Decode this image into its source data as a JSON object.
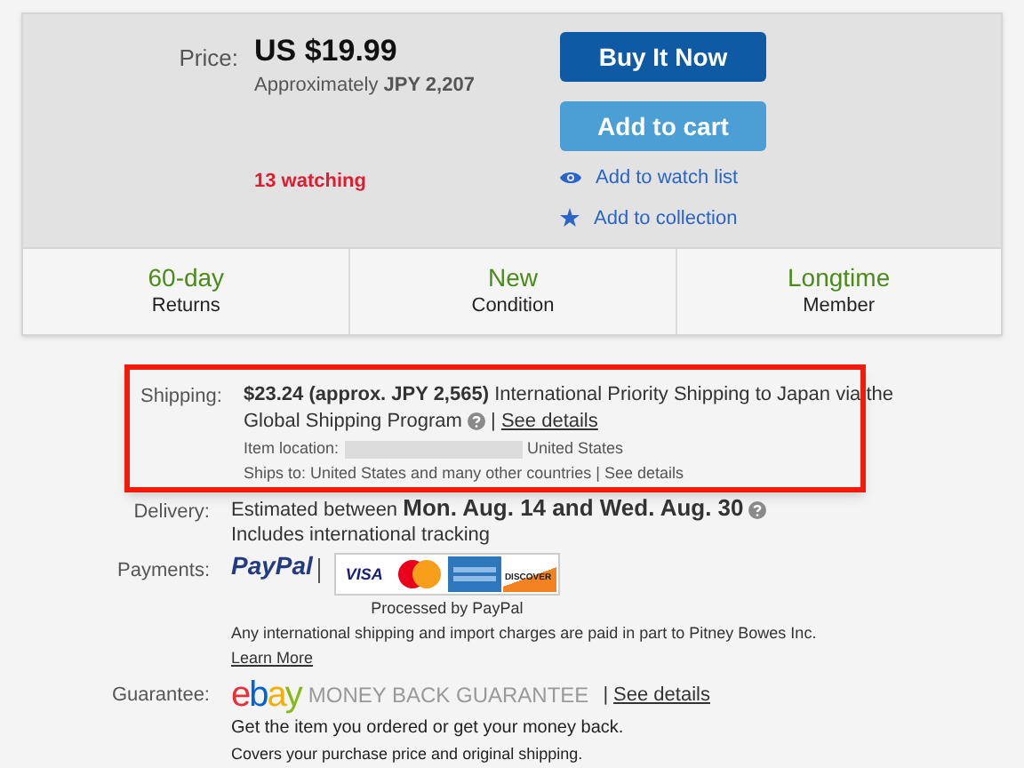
{
  "price": {
    "label": "Price:",
    "amount": "US $19.99",
    "approx_prefix": "Approximately",
    "approx_value": "JPY 2,207",
    "watching": "13 watching"
  },
  "actions": {
    "buttons": [
      {
        "label": "Buy It Now",
        "kind": "primary"
      },
      {
        "label": "Add to cart",
        "kind": "secondary"
      }
    ],
    "links": [
      {
        "label": "Add to watch list",
        "kind": "eye"
      },
      {
        "label": "Add to collection",
        "kind": "star"
      }
    ]
  },
  "features": [
    {
      "value": "60-day",
      "label": "Returns"
    },
    {
      "value": "New",
      "label": "Condition"
    },
    {
      "value": "Longtime",
      "label": "Member"
    }
  ],
  "shipping": {
    "label": "Shipping:",
    "cost": "$23.24",
    "approx": "(approx. JPY 2,565)",
    "method": "International Priority Shipping to Japan via the Global Shipping Program",
    "separator": "|",
    "details_link": "See details",
    "location_label": "Item location:",
    "location_value": "United States",
    "ships_to": "Ships to: United States and many other countries | See details",
    "highlighted": true
  },
  "delivery": {
    "label": "Delivery:",
    "prefix": "Estimated between",
    "dates": "Mon. Aug. 14 and Wed. Aug. 30",
    "note": "Includes international tracking"
  },
  "payments": {
    "label": "Payments:",
    "paypal": "PayPal",
    "cards": [
      {
        "kind": "visa",
        "label": "VISA"
      },
      {
        "kind": "mastercard"
      },
      {
        "kind": "amex"
      },
      {
        "kind": "discover",
        "label": "DISCOVER"
      }
    ],
    "processed": "Processed by PayPal",
    "notice": "Any international shipping and import charges are paid in part to Pitney Bowes Inc.",
    "learn_more": "Learn More"
  },
  "guarantee": {
    "label": "Guarantee:",
    "logo": "ebay",
    "title": "MONEY BACK GUARANTEE",
    "separator": "|",
    "details_link": "See details",
    "line1": "Get the item you ordered or get your money back.",
    "line2": "Covers your purchase price and original shipping."
  }
}
